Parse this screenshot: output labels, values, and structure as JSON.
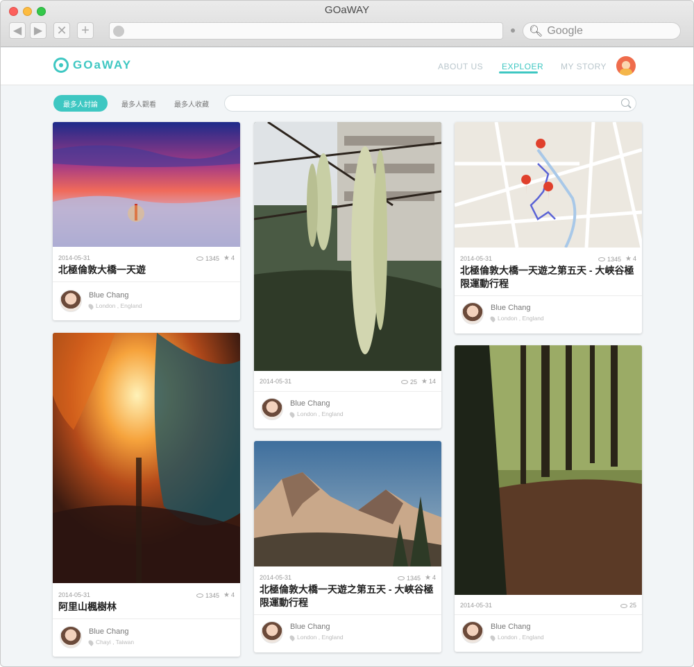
{
  "window": {
    "title": "GOaWAY"
  },
  "browser": {
    "search_placeholder": "Google",
    "url": ""
  },
  "site": {
    "logo": "GOaWAY",
    "nav": [
      "ABOUT US",
      "EXPLOER",
      "MY STORY"
    ],
    "active_nav": "EXPLOER",
    "accent": "#3ec7c2"
  },
  "filters": [
    "最多人討論",
    "最多人觀看",
    "最多人收藏"
  ],
  "active_filter": "最多人討論",
  "search": {
    "placeholder": ""
  },
  "cards": [
    {
      "date": "2014-05-31",
      "views": "1345",
      "stars": "4",
      "title": "北極倫敦大橋一天遊",
      "author": "Blue Chang",
      "location": "London , England",
      "image": "sunset-bridge-fog"
    },
    {
      "date": "2014-05-31",
      "views": "1345",
      "stars": "4",
      "title": "阿里山楓樹林",
      "author": "Blue Chang",
      "location": "Chayi , Taiwan",
      "image": "autumn-forest-sunlight"
    },
    {
      "date": "2014-05-31",
      "views": "25",
      "stars": "14",
      "title": "",
      "author": "Blue Chang",
      "location": "London , England",
      "image": "catkins-plant"
    },
    {
      "date": "2014-05-31",
      "views": "1345",
      "stars": "4",
      "title": "北極倫敦大橋一天遊之第五天 - 大峽谷極限運動行程",
      "author": "Blue Chang",
      "location": "London , England",
      "image": "mountain-peak"
    },
    {
      "date": "2014-05-31",
      "views": "1345",
      "stars": "4",
      "title": "北極倫敦大橋一天遊之第五天 - 大峽谷極限運動行程",
      "author": "Blue Chang",
      "location": "London , England",
      "image": "route-map"
    },
    {
      "date": "2014-05-31",
      "views": "25",
      "stars": "",
      "title": "",
      "author": "Blue Chang",
      "location": "London , England",
      "image": "forest-path"
    }
  ]
}
